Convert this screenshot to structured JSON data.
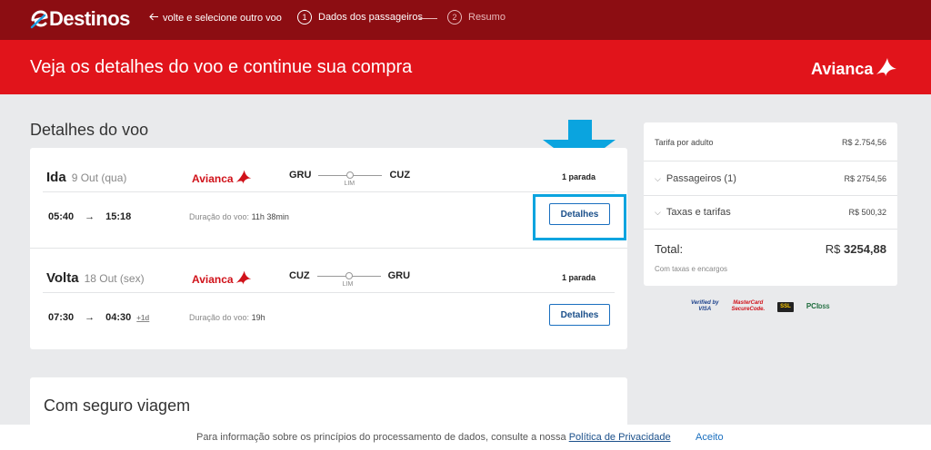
{
  "header": {
    "logo_text": "Destinos",
    "back_link": "volte e selecione outro voo",
    "steps": [
      {
        "num": "1",
        "label": "Dados dos passageiros"
      },
      {
        "num": "2",
        "label": "Resumo"
      }
    ]
  },
  "banner": {
    "title": "Veja os detalhes do voo e continue sua compra",
    "brand": "Avianca"
  },
  "flight_section": {
    "title": "Detalhes do voo",
    "legs": [
      {
        "direction": "Ida",
        "date": "9 Out (qua)",
        "airline": "Avianca",
        "origin": "GRU",
        "stop": "LIM",
        "destination": "CUZ",
        "stops_label": "1 parada",
        "depart": "05:40",
        "arrive": "15:18",
        "plus_day": "",
        "duration_label": "Duração do voo:",
        "duration": "11h 38min",
        "details_button": "Detalhes"
      },
      {
        "direction": "Volta",
        "date": "18 Out (sex)",
        "airline": "Avianca",
        "origin": "CUZ",
        "stop": "LIM",
        "destination": "GRU",
        "stops_label": "1 parada",
        "depart": "07:30",
        "arrive": "04:30",
        "plus_day": "+1d",
        "duration_label": "Duração do voo:",
        "duration": "19h",
        "details_button": "Detalhes"
      }
    ]
  },
  "seguro": {
    "title": "Com seguro viagem"
  },
  "price": {
    "fare_label": "Tarifa por adulto",
    "fare_value": "R$ 2.754,56",
    "passengers_label": "Passageiros (1)",
    "passengers_value": "R$ 2754,56",
    "taxes_label": "Taxas e tarifas",
    "taxes_value": "R$ 500,32",
    "total_label": "Total:",
    "total_currency": "R$",
    "total_value": "3254,88",
    "total_note": "Com taxas e encargos"
  },
  "badges": {
    "visa_line1": "Verified by",
    "visa_line2": "VISA",
    "mc_line1": "MasterCard",
    "mc_line2": "SecureCode.",
    "ssl": "SSL",
    "pci": "PCI",
    "pci_dss": "DSS"
  },
  "footer": {
    "text": "Para informação sobre os princípios do processamento de dados, consulte a nossa",
    "link": "Política de Privacidade",
    "accept": "Aceito"
  },
  "colors": {
    "topnav": "#8c0d12",
    "banner": "#e1141b",
    "accent_blue": "#0aa4df",
    "button_border": "#1a6fbf"
  }
}
